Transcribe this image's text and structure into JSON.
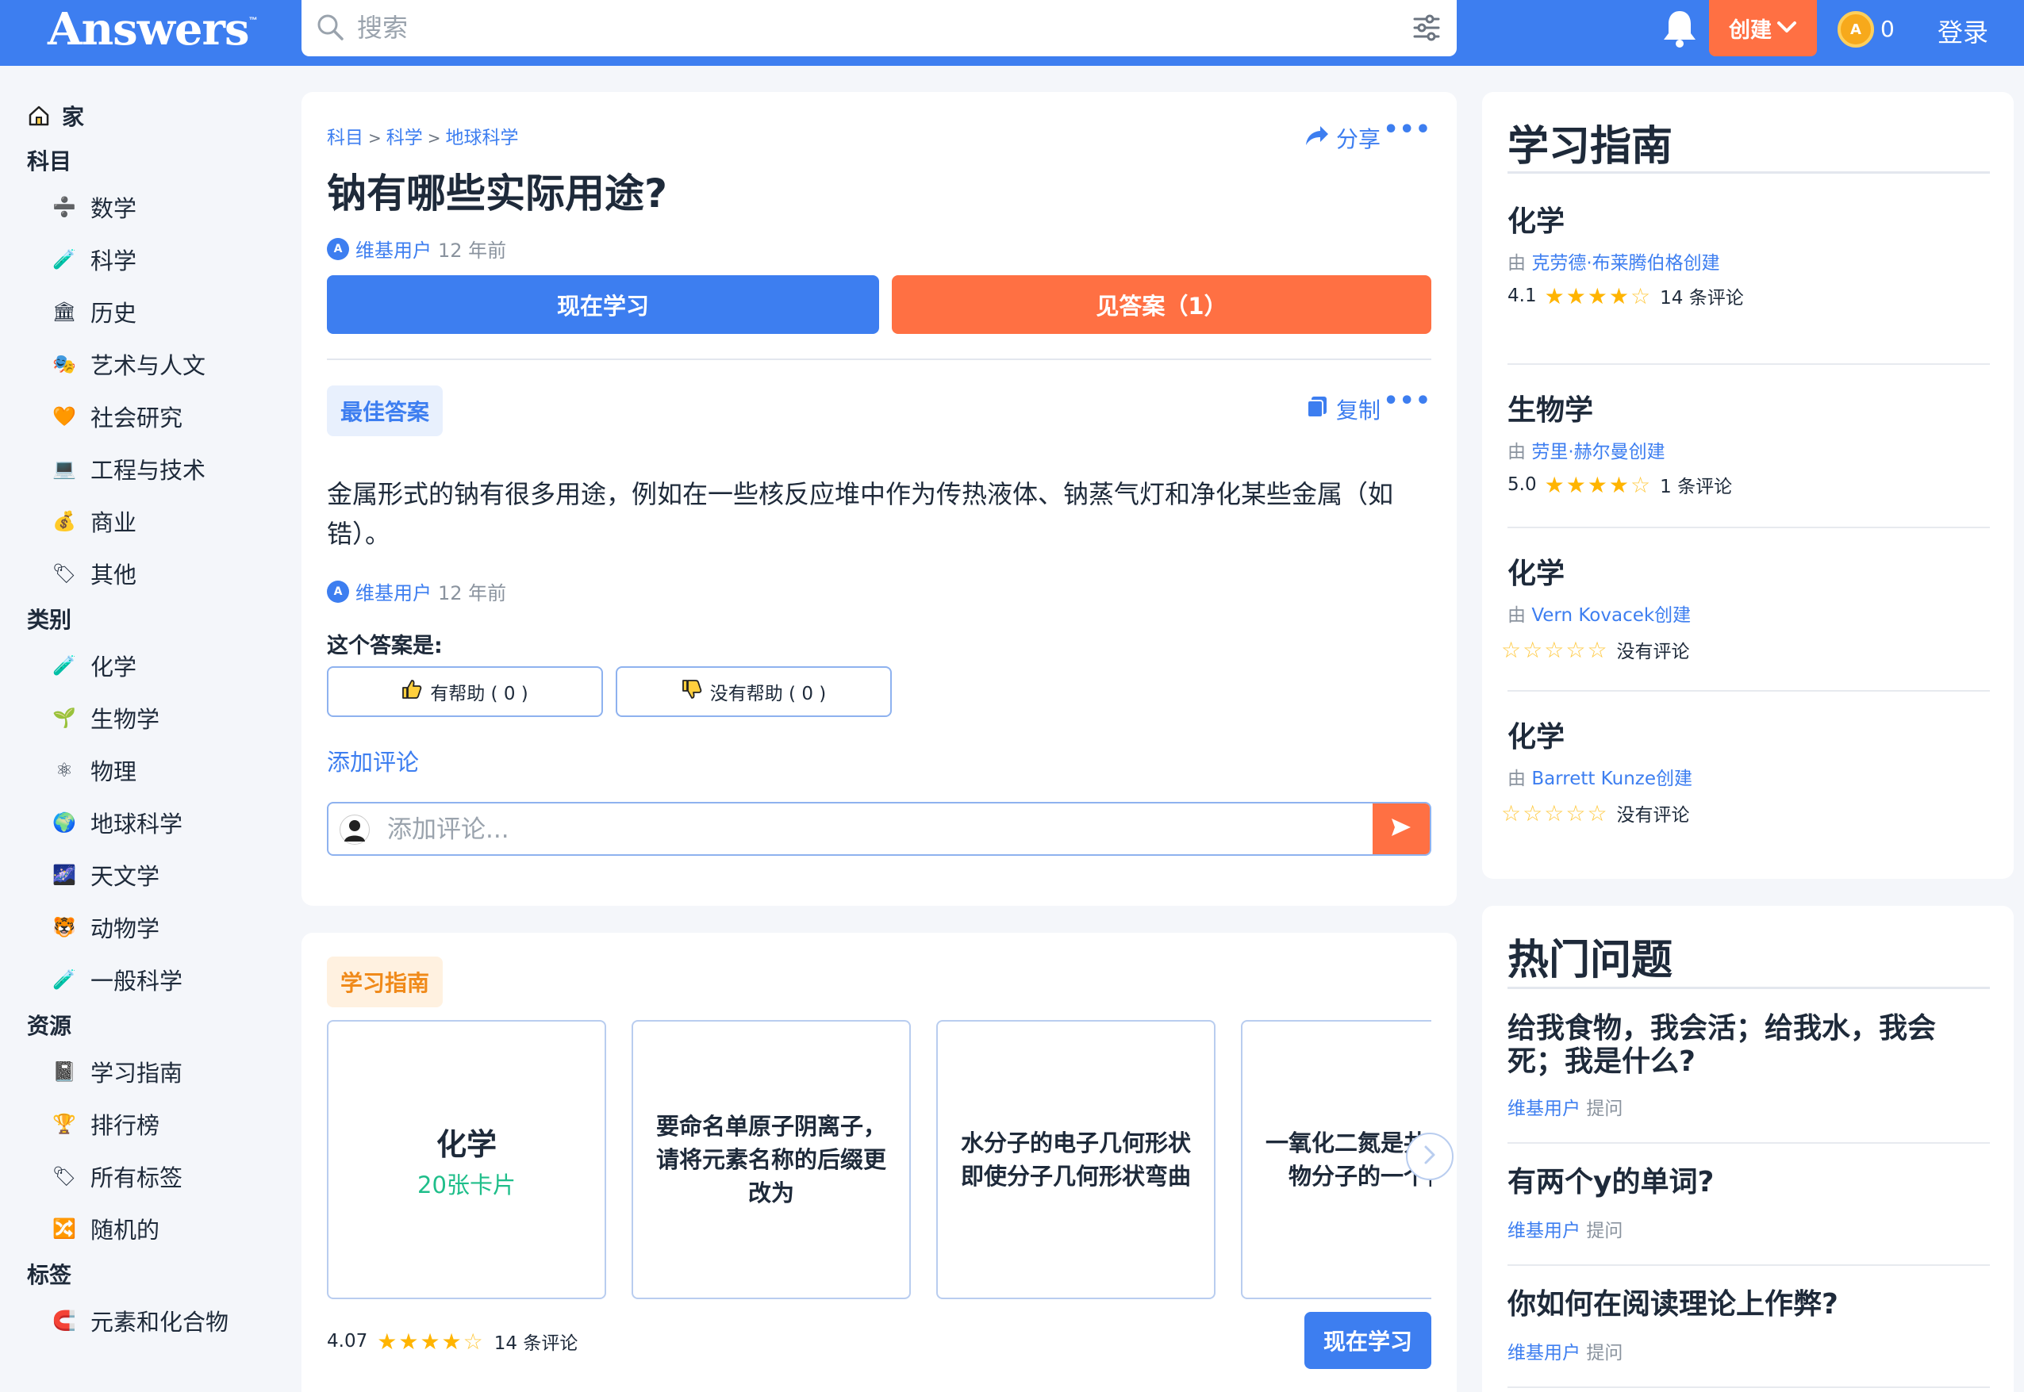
{
  "header": {
    "logo": "Answers",
    "logo_tm": "™",
    "search_placeholder": "搜索",
    "create_label": "创建",
    "coin_symbol": "A",
    "coin_count": "0",
    "login_label": "登录",
    "accent": "#3d7ef0",
    "orange": "#ff7043"
  },
  "sidebar": {
    "home": "家",
    "subjects_title": "科目",
    "subjects": [
      "数学",
      "科学",
      "历史",
      "艺术与人文",
      "社会研究",
      "工程与技术",
      "商业",
      "其他"
    ],
    "categories_title": "类别",
    "categories": [
      "化学",
      "生物学",
      "物理",
      "地球科学",
      "天文学",
      "动物学",
      "一般科学"
    ],
    "resources_title": "资源",
    "resources": [
      "学习指南",
      "排行榜",
      "所有标签",
      "随机的"
    ],
    "tags_title": "标签",
    "tags": [
      "元素和化合物"
    ]
  },
  "question": {
    "breadcrumb": [
      "科目",
      "科学",
      "地球科学"
    ],
    "breadcrumb_sep": ">",
    "share_label": "分享",
    "more": "•••",
    "title": "钠有哪些实际用途?",
    "author": "维基用户",
    "time": "12 年前",
    "study_now": "现在学习",
    "see_answer": "见答案（1）",
    "best_answer_label": "最佳答案",
    "copy_label": "复制",
    "answer_text": "金属形式的钠有很多用途，例如在一些核反应堆中作为传热液体、钠蒸气灯和净化某些金属（如锆）。",
    "answer_author": "维基用户",
    "answer_time": "12 年前",
    "helpful_prompt": "这个答案是:",
    "helpful_label": "有帮助 ( 0 )",
    "not_helpful_label": "没有帮助 ( 0 )",
    "add_comment": "添加评论",
    "comment_placeholder": "添加评论..."
  },
  "study_guide": {
    "badge": "学习指南",
    "cards": [
      {
        "title": "化学",
        "sub": "20张卡片"
      },
      {
        "title": "要命名单原子阴离子，请将元素名称的后缀更改为",
        "sub": ""
      },
      {
        "title": "水分子的电子几何形状即使分子几何形状弯曲",
        "sub": ""
      },
      {
        "title": "一氧化二氮是共价化合物分子的一个例子",
        "sub": ""
      }
    ],
    "rating": "4.07",
    "stars": 4.07,
    "reviews": "14 条评论",
    "study_now": "现在学习"
  },
  "right_guides": {
    "title": "学习指南",
    "by_prefix": "由",
    "items": [
      {
        "subject": "化学",
        "author": "克劳德·布莱腾伯格创建",
        "rating": "4.1",
        "stars": 3.5,
        "reviews": "14 条评论"
      },
      {
        "subject": "生物学",
        "author": "劳里·赫尔曼创建",
        "rating": "5.0",
        "stars": 4.0,
        "reviews": "1 条评论"
      },
      {
        "subject": "化学",
        "author": "Vern Kovacek创建",
        "rating": "",
        "stars": 0,
        "reviews": "没有评论"
      },
      {
        "subject": "化学",
        "author": "Barrett Kunze创建",
        "rating": "",
        "stars": 0,
        "reviews": "没有评论"
      }
    ]
  },
  "hot_questions": {
    "title": "热门问题",
    "asked_suffix": "提问",
    "items": [
      {
        "question": "给我食物，我会活；给我水，我会死；我是什么?",
        "author": "维基用户"
      },
      {
        "question": "有两个y的单词?",
        "author": "维基用户"
      },
      {
        "question": "你如何在阅读理论上作弊?",
        "author": "维基用户"
      }
    ]
  }
}
